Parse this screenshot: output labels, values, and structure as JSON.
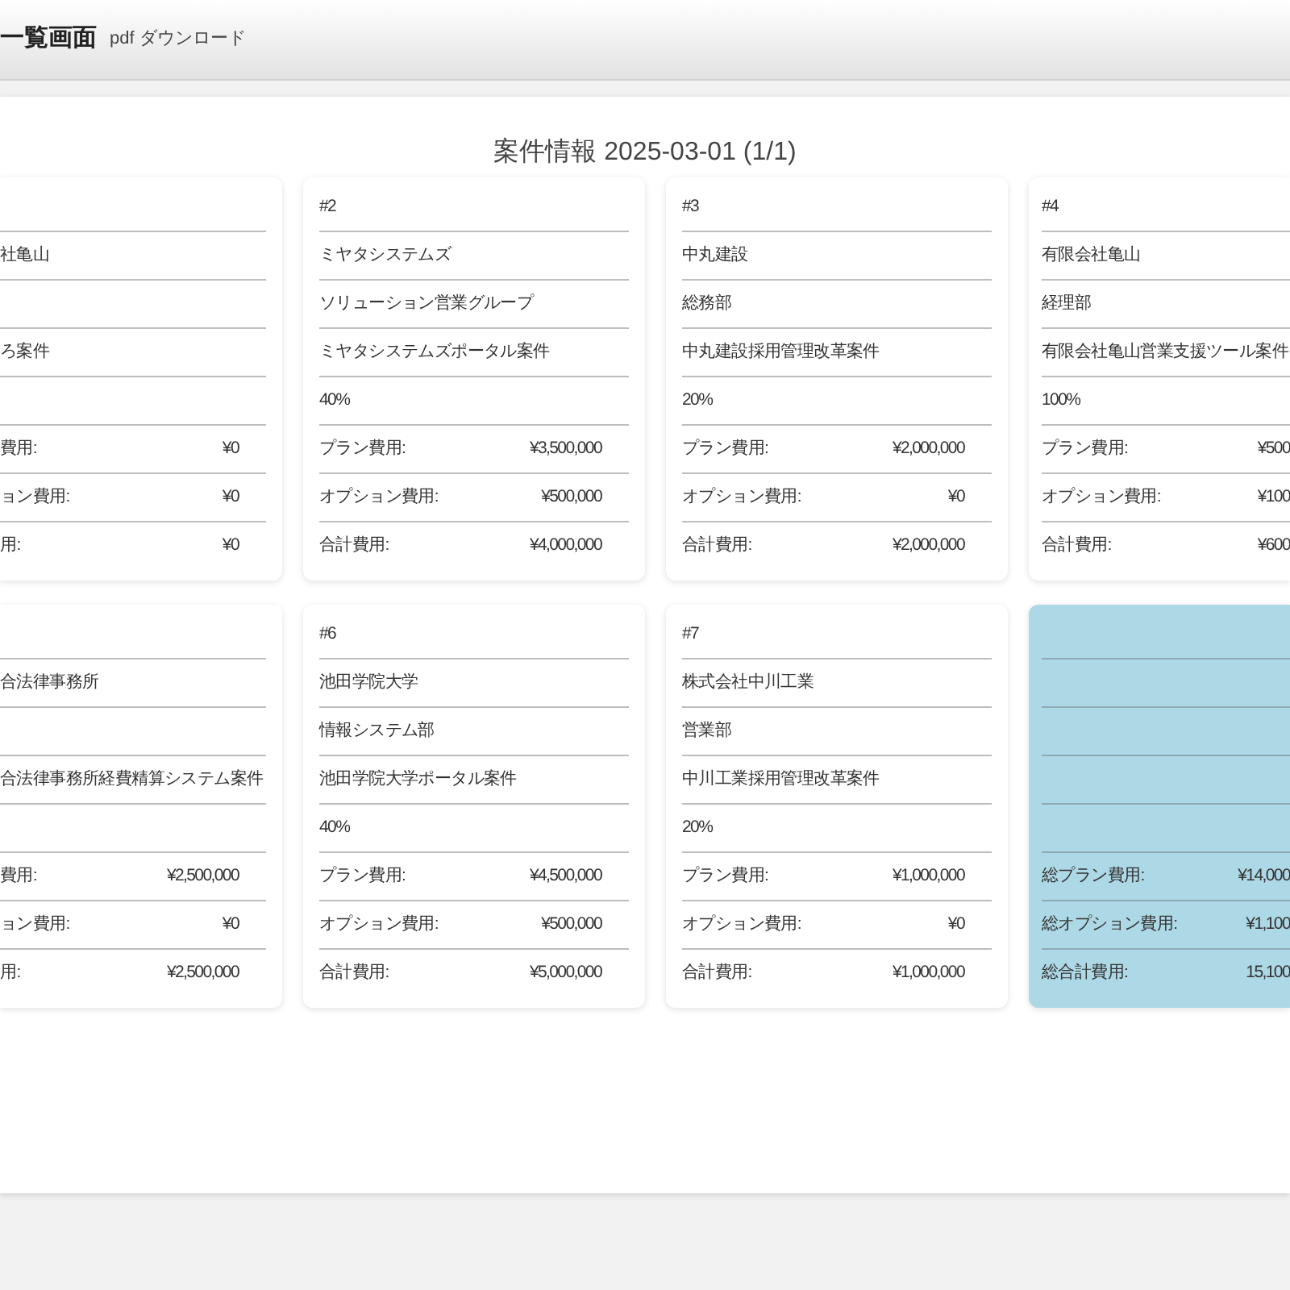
{
  "header": {
    "title": "一覧画面",
    "link": "pdf ダウンロード"
  },
  "report_title": "案件情報 2025-03-01 (1/1)",
  "cards": [
    {
      "kind": "project",
      "company": "社亀山",
      "project": "ろ案件",
      "costs": [
        {
          "label": "費用:",
          "value": "¥0"
        },
        {
          "label": "ョン費用:",
          "value": "¥0"
        },
        {
          "label": "用:",
          "value": "¥0"
        }
      ]
    },
    {
      "kind": "project",
      "number": "#2",
      "company": "ミヤタシステムズ",
      "department": "ソリューション営業グループ",
      "project": "ミヤタシステムズポータル案件",
      "progress": "40%",
      "costs": [
        {
          "label": "プラン費用:",
          "value": "¥3,500,000"
        },
        {
          "label": "オプション費用:",
          "value": "¥500,000"
        },
        {
          "label": "合計費用:",
          "value": "¥4,000,000"
        }
      ]
    },
    {
      "kind": "project",
      "number": "#3",
      "company": "中丸建設",
      "department": "総務部",
      "project": "中丸建設採用管理改革案件",
      "progress": "20%",
      "costs": [
        {
          "label": "プラン費用:",
          "value": "¥2,000,000"
        },
        {
          "label": "オプション費用:",
          "value": "¥0"
        },
        {
          "label": "合計費用:",
          "value": "¥2,000,000"
        }
      ]
    },
    {
      "kind": "project",
      "number": "#4",
      "company": "有限会社亀山",
      "department": "経理部",
      "project": "有限会社亀山営業支援ツール案件",
      "progress": "100%",
      "costs": [
        {
          "label": "プラン費用:",
          "value": "¥500"
        },
        {
          "label": "オプション費用:",
          "value": "¥100"
        },
        {
          "label": "合計費用:",
          "value": "¥600"
        }
      ]
    },
    {
      "kind": "project",
      "company": "合法律事務所",
      "project": "合法律事務所経費精算システム案件",
      "costs": [
        {
          "label": "費用:",
          "value": "¥2,500,000"
        },
        {
          "label": "ョン費用:",
          "value": "¥0"
        },
        {
          "label": "用:",
          "value": "¥2,500,000"
        }
      ]
    },
    {
      "kind": "project",
      "number": "#6",
      "company": "池田学院大学",
      "department": "情報システム部",
      "project": "池田学院大学ポータル案件",
      "progress": "40%",
      "costs": [
        {
          "label": "プラン費用:",
          "value": "¥4,500,000"
        },
        {
          "label": "オプション費用:",
          "value": "¥500,000"
        },
        {
          "label": "合計費用:",
          "value": "¥5,000,000"
        }
      ]
    },
    {
      "kind": "project",
      "number": "#7",
      "company": "株式会社中川工業",
      "department": "営業部",
      "project": "中川工業採用管理改革案件",
      "progress": "20%",
      "costs": [
        {
          "label": "プラン費用:",
          "value": "¥1,000,000"
        },
        {
          "label": "オプション費用:",
          "value": "¥0"
        },
        {
          "label": "合計費用:",
          "value": "¥1,000,000"
        }
      ]
    },
    {
      "kind": "summary",
      "costs": [
        {
          "label": "総プラン費用:",
          "value": "¥14,000"
        },
        {
          "label": "総オプション費用:",
          "value": "¥1,100"
        },
        {
          "label": "総合計費用:",
          "value": "15,100"
        }
      ]
    }
  ]
}
